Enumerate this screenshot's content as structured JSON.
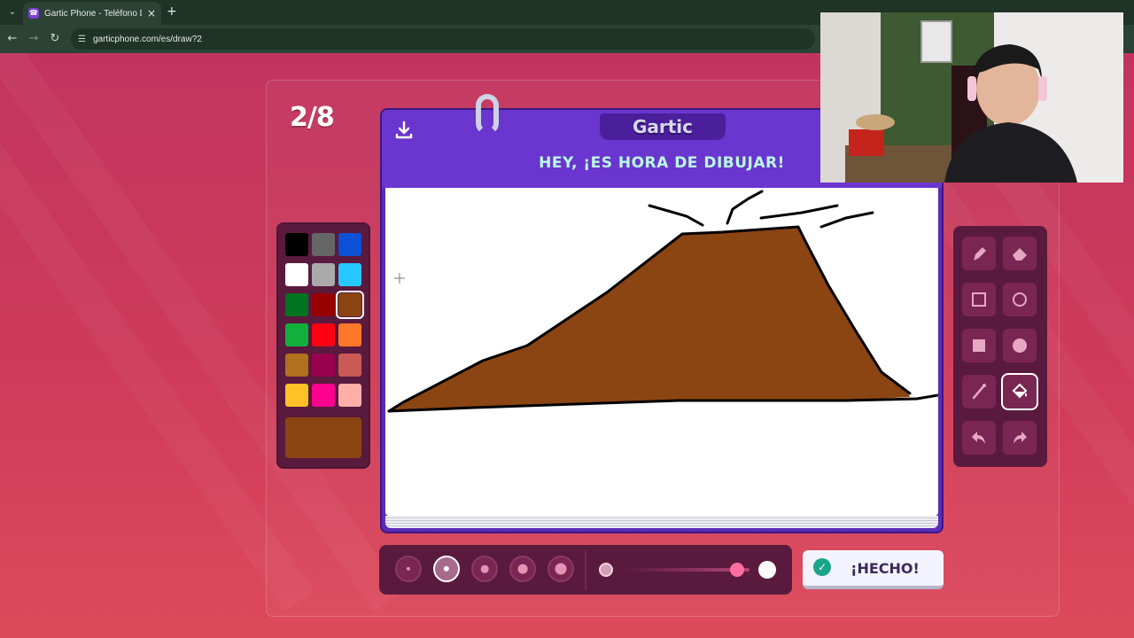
{
  "browser": {
    "tab_title": "Gartic Phone - Teléfono Descon",
    "tab_favicon": "phone",
    "tab_close": "×",
    "new_tab": "+",
    "tab_menu": "⌄",
    "url": "garticphone.com/es/draw?2",
    "back": "←",
    "forward": "→",
    "reload": "↻"
  },
  "game": {
    "round_counter": "2/8",
    "logo": "Gartic",
    "prompt": "HEY, ¡ES HORA DE DIBUJAR!",
    "done_label": "¡HECHO!",
    "selected_color": "#8b4513",
    "palette": [
      "#000000",
      "#666666",
      "#0c50d6",
      "#ffffff",
      "#aaaaaa",
      "#26c9ff",
      "#017420",
      "#990000",
      "#8b4513",
      "#11b03c",
      "#ff0013",
      "#ff7829",
      "#b0701c",
      "#99004e",
      "#cb5a57",
      "#ffc126",
      "#ff008f",
      "#feafa8"
    ],
    "tools": [
      {
        "name": "pencil",
        "icon": "pencil-icon"
      },
      {
        "name": "eraser",
        "icon": "eraser-icon"
      },
      {
        "name": "rectangle-outline",
        "icon": "square-outline-icon"
      },
      {
        "name": "ellipse-outline",
        "icon": "circle-outline-icon"
      },
      {
        "name": "rectangle-filled",
        "icon": "square-filled-icon"
      },
      {
        "name": "ellipse-filled",
        "icon": "circle-filled-icon"
      },
      {
        "name": "line",
        "icon": "line-icon"
      },
      {
        "name": "fill",
        "icon": "paint-bucket-icon"
      },
      {
        "name": "undo",
        "icon": "undo-icon"
      },
      {
        "name": "redo",
        "icon": "redo-icon"
      }
    ],
    "active_tool": "fill",
    "brush_sizes": [
      1,
      2,
      3,
      4,
      5
    ],
    "selected_brush_size": 2,
    "opacity_percent": 90
  },
  "colors": {
    "page_bg": "#c8365c",
    "board": "#5b2bb8",
    "prompt_text": "#b8fbe5",
    "drawing_fill": "#8b4513"
  }
}
